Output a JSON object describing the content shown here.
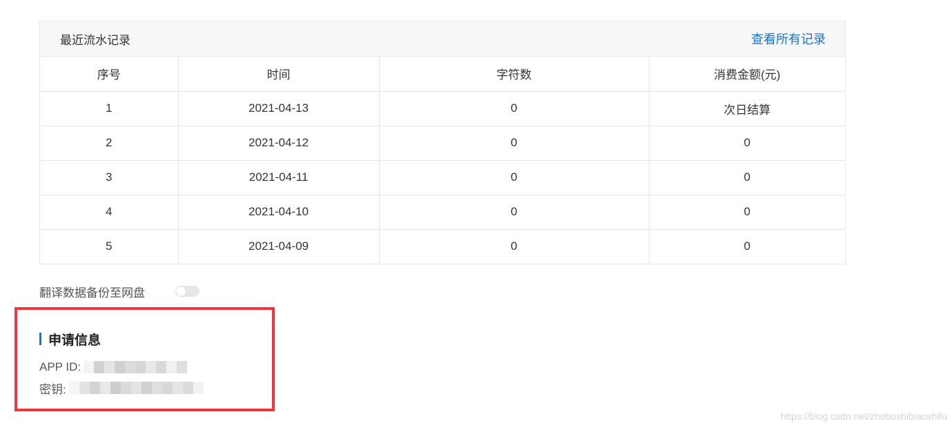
{
  "records": {
    "title": "最近流水记录",
    "view_all": "查看所有记录",
    "columns": [
      "序号",
      "时间",
      "字符数",
      "消费金额(元)"
    ],
    "rows": [
      [
        "1",
        "2021-04-13",
        "0",
        "次日结算"
      ],
      [
        "2",
        "2021-04-12",
        "0",
        "0"
      ],
      [
        "3",
        "2021-04-11",
        "0",
        "0"
      ],
      [
        "4",
        "2021-04-10",
        "0",
        "0"
      ],
      [
        "5",
        "2021-04-09",
        "0",
        "0"
      ]
    ]
  },
  "backup": {
    "label": "翻译数据备份至网盘",
    "enabled": false
  },
  "apply_info": {
    "title": "申请信息",
    "app_id_label": "APP ID:",
    "secret_label": "密钥:"
  },
  "colors": {
    "accent": "#1a73c9",
    "highlight": "#f1363b"
  },
  "watermark": "https://blog.csdn.net/zhebushibiaoshifu"
}
